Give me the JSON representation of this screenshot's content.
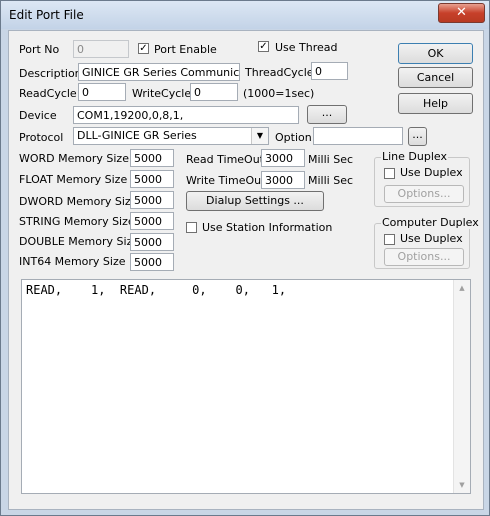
{
  "window": {
    "title": "Edit Port File",
    "close_label": "✕"
  },
  "port_no": {
    "label": "Port No",
    "value": "0"
  },
  "port_enable": {
    "label": "Port Enable",
    "checked": true
  },
  "use_thread": {
    "label": "Use Thread",
    "checked": true
  },
  "description": {
    "label": "Description",
    "value": "GINICE GR Series Communication"
  },
  "thread_cycle": {
    "label": "ThreadCycle",
    "value": "0"
  },
  "read_cycle": {
    "label": "ReadCycle",
    "value": "0"
  },
  "write_cycle": {
    "label": "WriteCycle",
    "value": "0",
    "hint": "(1000=1sec)"
  },
  "device": {
    "label": "Device",
    "value": "COM1,19200,0,8,1,",
    "button": "..."
  },
  "protocol": {
    "label": "Protocol",
    "value": "DLL-GINICE GR Series"
  },
  "option": {
    "label": "Option",
    "value": "",
    "button": "..."
  },
  "memory": [
    {
      "label": "WORD Memory Size",
      "value": "5000"
    },
    {
      "label": "FLOAT Memory Size",
      "value": "5000"
    },
    {
      "label": "DWORD Memory Size",
      "value": "5000"
    },
    {
      "label": "STRING Memory Size",
      "value": "5000"
    },
    {
      "label": "DOUBLE Memory Size",
      "value": "5000"
    },
    {
      "label": "INT64 Memory Size",
      "value": "5000"
    }
  ],
  "read_timeout": {
    "label": "Read TimeOut",
    "value": "3000",
    "unit": "Milli Sec"
  },
  "write_timeout": {
    "label": "Write TimeOut",
    "value": "3000",
    "unit": "Milli Sec"
  },
  "dialup_button": "Dialup Settings ...",
  "use_station_info": {
    "label": "Use Station Information",
    "checked": false
  },
  "line_duplex": {
    "title": "Line Duplex",
    "checkbox": "Use Duplex",
    "options_button": "Options..."
  },
  "computer_duplex": {
    "title": "Computer Duplex",
    "checkbox": "Use Duplex",
    "options_button": "Options..."
  },
  "buttons": {
    "ok": "OK",
    "cancel": "Cancel",
    "help": "Help"
  },
  "memo_text": "READ,    1,  READ,     0,    0,   1,"
}
